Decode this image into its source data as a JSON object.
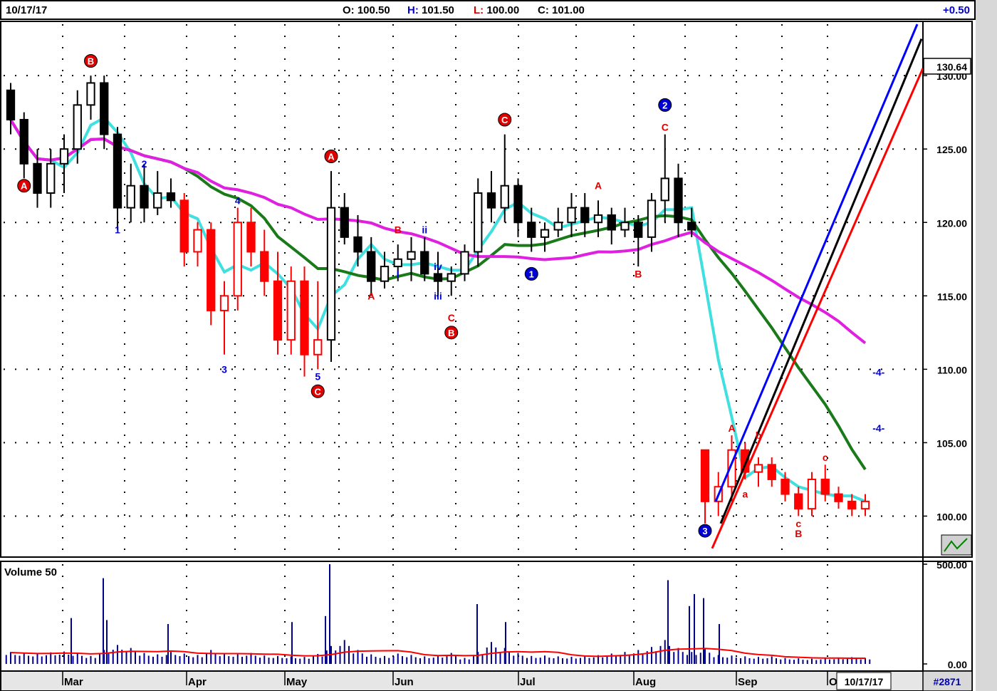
{
  "header": {
    "date": "10/17/17",
    "open_label": "O:",
    "open": "100.50",
    "high_label": "H:",
    "high": "101.50",
    "low_label": "L:",
    "low": "100.00",
    "close_label": "C:",
    "close": "101.00",
    "change": "+0.50"
  },
  "footer": {
    "current_date": "10/17/17",
    "bar_count": "#2871"
  },
  "chart_data": {
    "type": "candlestick",
    "price_axis": {
      "ylim": [
        97.5,
        133.5
      ],
      "ticks": [
        "130.00",
        "125.00",
        "120.00",
        "115.00",
        "110.00",
        "105.00",
        "100.00"
      ],
      "tick_values": [
        130,
        125,
        120,
        115,
        110,
        105,
        100
      ]
    },
    "last_price_label": "130.64",
    "x_months": [
      "Mar",
      "Apr",
      "May",
      "Jun",
      "Jul",
      "Aug",
      "Sep",
      "O"
    ],
    "volume_panel": {
      "label": "Volume 50",
      "ticks": [
        "500.00",
        "0.00"
      ],
      "tick_values": [
        500,
        0
      ]
    },
    "colors": {
      "bull": "#000000",
      "bear_red": "#ff0000",
      "ma_fast": "#40e0e0",
      "ma_mid": "#1a7a1a",
      "ma_slow": "#e020e0",
      "line_blue": "#0000ff",
      "line_black": "#000000",
      "line_red": "#ff0000",
      "volume_bar": "#00008b",
      "volume_avg": "#ff0000"
    },
    "candles": [
      [
        129,
        129.5,
        126,
        127
      ],
      [
        127,
        127.5,
        123,
        124
      ],
      [
        124,
        125,
        121,
        122
      ],
      [
        122,
        125,
        121,
        124
      ],
      [
        124,
        126,
        122,
        125
      ],
      [
        125,
        129,
        124,
        128
      ],
      [
        128,
        130,
        127,
        129.5
      ],
      [
        129.5,
        130,
        125,
        126
      ],
      [
        126,
        126.5,
        119.5,
        121
      ],
      [
        121,
        124,
        120,
        122.5
      ],
      [
        122.5,
        124,
        120,
        121
      ],
      [
        121,
        123.5,
        120.5,
        122
      ],
      [
        122,
        123,
        121,
        121.5
      ],
      [
        121.5,
        122,
        117,
        118
      ],
      [
        118,
        120,
        117,
        119.5
      ],
      [
        119.5,
        120,
        113,
        114
      ],
      [
        114,
        116,
        111,
        115
      ],
      [
        115,
        121,
        114,
        120
      ],
      [
        120,
        121,
        117,
        118
      ],
      [
        118,
        119.5,
        115,
        116
      ],
      [
        116,
        118,
        111,
        112
      ],
      [
        112,
        117,
        111,
        116
      ],
      [
        116,
        117,
        109.5,
        111
      ],
      [
        111,
        116,
        110,
        112
      ],
      [
        112,
        123.5,
        110.5,
        121
      ],
      [
        121,
        122,
        118.5,
        119
      ],
      [
        119,
        120.5,
        117,
        118
      ],
      [
        118,
        119,
        115,
        116
      ],
      [
        116,
        118,
        115.5,
        117
      ],
      [
        117,
        118.5,
        116,
        117.5
      ],
      [
        117.5,
        119,
        116,
        118
      ],
      [
        118,
        119,
        116,
        116.5
      ],
      [
        116.5,
        118,
        115,
        116
      ],
      [
        116,
        117,
        115,
        116.5
      ],
      [
        116.5,
        118.5,
        116,
        118
      ],
      [
        118,
        123,
        117,
        122
      ],
      [
        122,
        123.5,
        120,
        121
      ],
      [
        121,
        126,
        120,
        122.5
      ],
      [
        122.5,
        123,
        119,
        120
      ],
      [
        120,
        121,
        118,
        119
      ],
      [
        119,
        120,
        118,
        119.5
      ],
      [
        119.5,
        121,
        119,
        120
      ],
      [
        120,
        122,
        119,
        121
      ],
      [
        121,
        122,
        119,
        120
      ],
      [
        120,
        121.5,
        119,
        120.5
      ],
      [
        120.5,
        121,
        118.5,
        119.5
      ],
      [
        119.5,
        121,
        119,
        120
      ],
      [
        120,
        120.5,
        117,
        119
      ],
      [
        119,
        122,
        118,
        121.5
      ],
      [
        121.5,
        126,
        120,
        123
      ],
      [
        123,
        124,
        119,
        120
      ],
      [
        120,
        121,
        119,
        119.5
      ],
      [
        104.5,
        104.5,
        99.5,
        101
      ],
      [
        101,
        103,
        100,
        102
      ],
      [
        102,
        105.5,
        101,
        104.5
      ],
      [
        104.5,
        105,
        102.5,
        103
      ],
      [
        103,
        104,
        102,
        103.5
      ],
      [
        103.5,
        104,
        102,
        102.5
      ],
      [
        102.5,
        103,
        101,
        101.5
      ],
      [
        101.5,
        102,
        100,
        100.5
      ],
      [
        100.5,
        103,
        100,
        102.5
      ],
      [
        102.5,
        103.5,
        101,
        101.5
      ],
      [
        101.5,
        102,
        100.5,
        101
      ],
      [
        101,
        101.5,
        100,
        100.5
      ],
      [
        100.5,
        101.5,
        100,
        101
      ]
    ],
    "annotations": [
      {
        "text": "A",
        "x": 1,
        "y": 122.5,
        "style": "circle-red"
      },
      {
        "text": "B",
        "x": 6,
        "y": 131,
        "style": "circle-red"
      },
      {
        "text": "1",
        "x": 8,
        "y": 119.5,
        "style": "text-blue"
      },
      {
        "text": "2",
        "x": 10,
        "y": 124,
        "style": "text-blue"
      },
      {
        "text": "4",
        "x": 17,
        "y": 121.5,
        "style": "text-blue"
      },
      {
        "text": "3",
        "x": 16,
        "y": 110,
        "style": "text-blue"
      },
      {
        "text": "5",
        "x": 23,
        "y": 109.5,
        "style": "text-blue"
      },
      {
        "text": "C",
        "x": 23,
        "y": 108.5,
        "style": "circle-red"
      },
      {
        "text": "A",
        "x": 24,
        "y": 124.5,
        "style": "circle-red"
      },
      {
        "text": "A",
        "x": 27,
        "y": 115,
        "style": "text-red"
      },
      {
        "text": "B",
        "x": 29,
        "y": 119.5,
        "style": "text-red"
      },
      {
        "text": "i",
        "x": 29,
        "y": 116.5,
        "style": "text-blue"
      },
      {
        "text": "ii",
        "x": 31,
        "y": 119.5,
        "style": "text-blue"
      },
      {
        "text": "iv",
        "x": 32,
        "y": 117,
        "style": "text-blue"
      },
      {
        "text": "iii",
        "x": 32,
        "y": 115,
        "style": "text-blue"
      },
      {
        "text": "C",
        "x": 33,
        "y": 113.5,
        "style": "text-red"
      },
      {
        "text": "B",
        "x": 33,
        "y": 112.5,
        "style": "circle-red"
      },
      {
        "text": "C",
        "x": 37,
        "y": 127,
        "style": "circle-red"
      },
      {
        "text": "1",
        "x": 39,
        "y": 116.5,
        "style": "circle-blue"
      },
      {
        "text": "A",
        "x": 44,
        "y": 122.5,
        "style": "text-red"
      },
      {
        "text": "B",
        "x": 47,
        "y": 116.5,
        "style": "text-red"
      },
      {
        "text": "2",
        "x": 49,
        "y": 128,
        "style": "circle-blue"
      },
      {
        "text": "C",
        "x": 49,
        "y": 126.5,
        "style": "text-red"
      },
      {
        "text": "3",
        "x": 52,
        "y": 99,
        "style": "circle-blue"
      },
      {
        "text": "A",
        "x": 54,
        "y": 106,
        "style": "text-red"
      },
      {
        "text": "a",
        "x": 55,
        "y": 101.5,
        "style": "text-red"
      },
      {
        "text": "b",
        "x": 56,
        "y": 105.5,
        "style": "text-red"
      },
      {
        "text": "c",
        "x": 59,
        "y": 99.5,
        "style": "text-red"
      },
      {
        "text": "B",
        "x": 59,
        "y": 98.8,
        "style": "text-red"
      },
      {
        "text": "c",
        "x": 61,
        "y": 104,
        "style": "text-red"
      },
      {
        "text": "-4-",
        "x": 65,
        "y": 109.8,
        "style": "text-blue"
      },
      {
        "text": "-4-",
        "x": 65,
        "y": 106,
        "style": "text-blue"
      }
    ],
    "volume": [
      60,
      55,
      50,
      58,
      62,
      54,
      40,
      70,
      95,
      80,
      55,
      48,
      60,
      52,
      45,
      70,
      52,
      48,
      55,
      42,
      40,
      38,
      35,
      50,
      90,
      120,
      70,
      48,
      40,
      52,
      45,
      38,
      42,
      55,
      30,
      60,
      110,
      80,
      55,
      40,
      42,
      38,
      36,
      40,
      44,
      52,
      60,
      70,
      85,
      120,
      80,
      60,
      75,
      45,
      42,
      38,
      35,
      38,
      30,
      28,
      26,
      30,
      32,
      34,
      30
    ]
  }
}
